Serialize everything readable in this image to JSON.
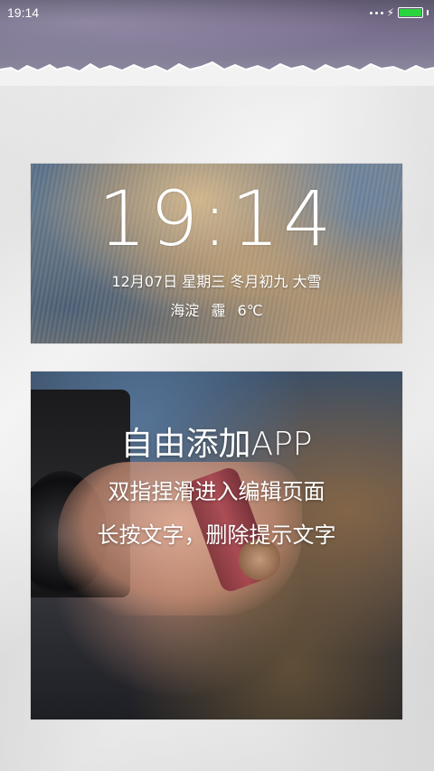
{
  "status_bar": {
    "time": "19:14",
    "battery_level": 1.0,
    "icons": [
      "signal-dots-icon",
      "charging-bolt-icon",
      "battery-icon"
    ],
    "battery_color": "#2bd33f"
  },
  "clock_widget": {
    "time": "19:14",
    "date": "12月07日 星期三 冬月初九 大雪",
    "location": "海淀",
    "weather": "霾",
    "temperature": "6℃"
  },
  "app_widget": {
    "title": "自由添加APP",
    "hint_1": "双指捏滑进入编辑页面",
    "hint_2": "长按文字，删除提示文字"
  }
}
